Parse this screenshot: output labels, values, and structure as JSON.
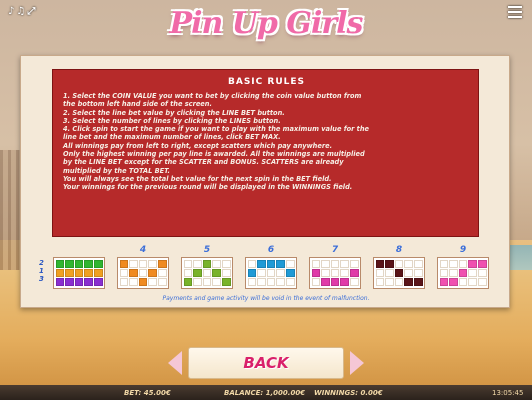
{
  "top_bar": {
    "icons": [
      "sound-icon",
      "music-icon",
      "fullscreen-icon"
    ],
    "menu_icon": "menu-icon"
  },
  "logo": "Pin Up Girls",
  "rules": {
    "title": "BASIC RULES",
    "lines": [
      "1. Select the COIN VALUE you want to bet by clicking the coin value button from",
      "the bottom left hand side of the screen.",
      "2. Select the line bet value by clicking the LINE BET button.",
      "3. Select the number of lines by clicking the LINES button.",
      "4. Click spin to start the game if you want to play with the maximum value for the",
      "line bet and the maximum number of lines, click BET MAX.",
      "All winnings pay from left to right, except scatters which pay anywhere.",
      "Only the highest winning per pay line is awarded. All the winnings are multiplied",
      "by the LINE BET except for the SCATTER and BONUS. SCATTERS are already",
      "multiplied by the TOTAL BET.",
      "You will always see the total bet value for the next spin in the BET field.",
      "Your winnings for the previous round will be displayed in the WINNINGS field."
    ]
  },
  "paylines": {
    "side_numbers": [
      "2",
      "1",
      "3"
    ],
    "items": [
      {
        "label": "",
        "color": "#8a2fd0",
        "rows": [
          [
            1,
            1,
            1,
            1,
            1
          ],
          [
            1,
            1,
            1,
            1,
            1
          ],
          [
            1,
            1,
            1,
            1,
            1
          ]
        ],
        "row_colors": [
          "#2fb52f",
          "#f0a020",
          "#8a2fd0"
        ]
      },
      {
        "label": "4",
        "color": "#f08a20",
        "rows": [
          [
            1,
            0,
            0,
            0,
            1
          ],
          [
            0,
            1,
            0,
            1,
            0
          ],
          [
            0,
            0,
            1,
            0,
            0
          ]
        ]
      },
      {
        "label": "5",
        "color": "#79b32a",
        "rows": [
          [
            0,
            0,
            1,
            0,
            0
          ],
          [
            0,
            1,
            0,
            1,
            0
          ],
          [
            1,
            0,
            0,
            0,
            1
          ]
        ]
      },
      {
        "label": "6",
        "color": "#1f9ad6",
        "rows": [
          [
            0,
            1,
            1,
            1,
            0
          ],
          [
            1,
            0,
            0,
            0,
            1
          ],
          [
            0,
            0,
            0,
            0,
            0
          ]
        ]
      },
      {
        "label": "7",
        "color": "#e03aa8",
        "rows": [
          [
            0,
            0,
            0,
            0,
            0
          ],
          [
            1,
            0,
            0,
            0,
            1
          ],
          [
            0,
            1,
            1,
            1,
            0
          ]
        ]
      },
      {
        "label": "8",
        "color": "#5a1418",
        "rows": [
          [
            1,
            1,
            0,
            0,
            0
          ],
          [
            0,
            0,
            1,
            0,
            0
          ],
          [
            0,
            0,
            0,
            1,
            1
          ]
        ]
      },
      {
        "label": "9",
        "color": "#f050b0",
        "rows": [
          [
            0,
            0,
            0,
            1,
            1
          ],
          [
            0,
            0,
            1,
            0,
            0
          ],
          [
            1,
            1,
            0,
            0,
            0
          ]
        ]
      }
    ],
    "disclaimer": "Payments and game activity will be void in the event of malfunction."
  },
  "back_button": {
    "label": "BACK"
  },
  "status_bar": {
    "bet": "BET: 45.00€",
    "balance": "BALANCE: 1,000.00€",
    "winnings": "WINNINGS: 0.00€",
    "time": "13:05:45"
  }
}
